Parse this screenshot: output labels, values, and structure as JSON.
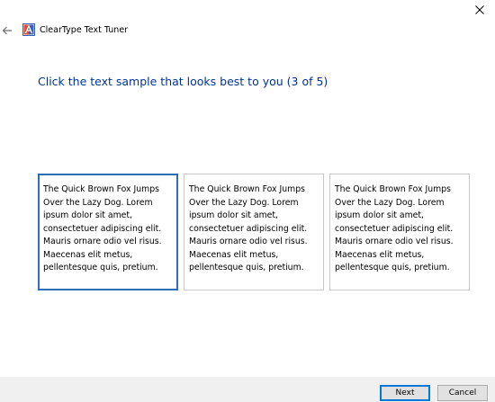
{
  "window": {
    "close_icon": "close-icon"
  },
  "header": {
    "back_icon": "back-arrow-icon",
    "app_icon": "cleartype-icon",
    "title": "ClearType Text Tuner"
  },
  "main": {
    "instruction": "Click the text sample that looks best to you (3 of 5)",
    "samples": [
      {
        "text": "The Quick Brown Fox Jumps\nOver the Lazy Dog. Lorem\nipsum dolor sit amet,\nconsectetuer adipiscing elit.\nMauris ornare odio vel risus.\nMaecenas elit metus,\npellentesque quis, pretium.",
        "selected": true
      },
      {
        "text": "The Quick Brown Fox Jumps\nOver the Lazy Dog. Lorem\nipsum dolor sit amet,\nconsectetuer adipiscing elit.\nMauris ornare odio vel risus.\nMaecenas elit metus,\npellentesque quis, pretium.",
        "selected": false
      },
      {
        "text": "The Quick Brown Fox Jumps\nOver the Lazy Dog. Lorem\nipsum dolor sit amet,\nconsectetuer adipiscing elit.\nMauris ornare odio vel risus.\nMaecenas elit metus,\npellentesque quis, pretium.",
        "selected": false
      }
    ]
  },
  "footer": {
    "next_label": "Next",
    "cancel_label": "Cancel"
  },
  "colors": {
    "instruction": "#003399",
    "selected_border": "#2c6fb8",
    "sample_border": "#c8c8c8",
    "footer_bg": "#f0f0f0",
    "default_button_border": "#0078d7"
  }
}
